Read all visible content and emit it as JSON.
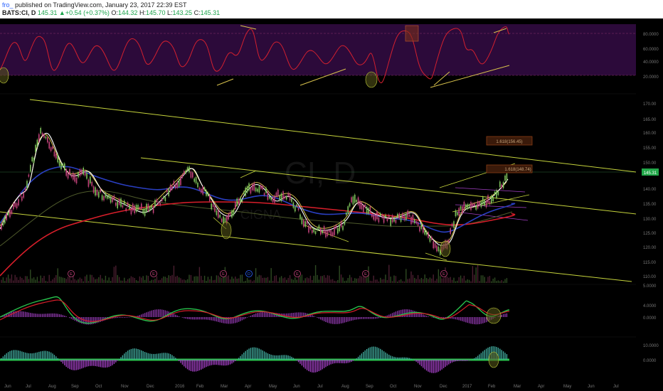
{
  "header": {
    "author": "fro_",
    "published": "published on TradingView.com, January 23, 2017 22:39 EST",
    "symbol": "BATS:CI, D",
    "last": "145.31",
    "change": "+0.54 (+0.37%)",
    "open_label": "O:",
    "open": "144.32",
    "high_label": "H:",
    "high": "145.70",
    "low_label": "L:",
    "low": "143.25",
    "close_label": "C:",
    "close": "145.31",
    "up_arrow": "▲"
  },
  "watermark": {
    "symbol": "CI, D",
    "name": "CIGNA"
  },
  "price_badge": "145.31",
  "fib_labels": [
    "1.618(156.45)",
    "1.618(148.74)"
  ],
  "earnings_marker": "E",
  "dividend_marker": "D",
  "x_axis": [
    "Jun",
    "Jul",
    "Aug",
    "Sep",
    "Oct",
    "Nov",
    "Dec",
    "2016",
    "Feb",
    "Mar",
    "Apr",
    "May",
    "Jun",
    "Jul",
    "Aug",
    "Sep",
    "Oct",
    "Nov",
    "Dec",
    "2017",
    "Feb",
    "Mar",
    "Apr",
    "May",
    "Jun",
    "Jul"
  ],
  "price_axis": [
    "170.00",
    "165.00",
    "160.00",
    "155.00",
    "150.00",
    "140.00",
    "135.00",
    "130.00",
    "125.00",
    "120.00",
    "115.00",
    "110.00",
    "5.0000",
    "0.0000"
  ],
  "rsi_axis": [
    "80.0000",
    "60.0000",
    "40.0000",
    "20.0000"
  ],
  "macd_axis": [
    "4.0000",
    "0.0000"
  ],
  "hist_axis": [
    "10.0000",
    "0.0000"
  ],
  "colors": {
    "background": "#000000",
    "rsi_band": "#2c0a3a",
    "rsi_line": "#d3202f",
    "channel": "#c6d43c",
    "ema_white": "#ffffff",
    "ema_yellow": "#d8c24c",
    "ma_blue": "#2a3fc2",
    "ma_red": "#d81e2a",
    "ma_olive": "#4e5a2b",
    "candle_up": "#7ec25a",
    "candle_down": "#c2427a",
    "fib_box": "#8a3d14",
    "macd_green": "#28c24c",
    "macd_red": "#d81e2a",
    "hist_teal": "#3fa79a",
    "hist_purple": "#a13fc2",
    "price_badge": "#22a84a"
  }
}
